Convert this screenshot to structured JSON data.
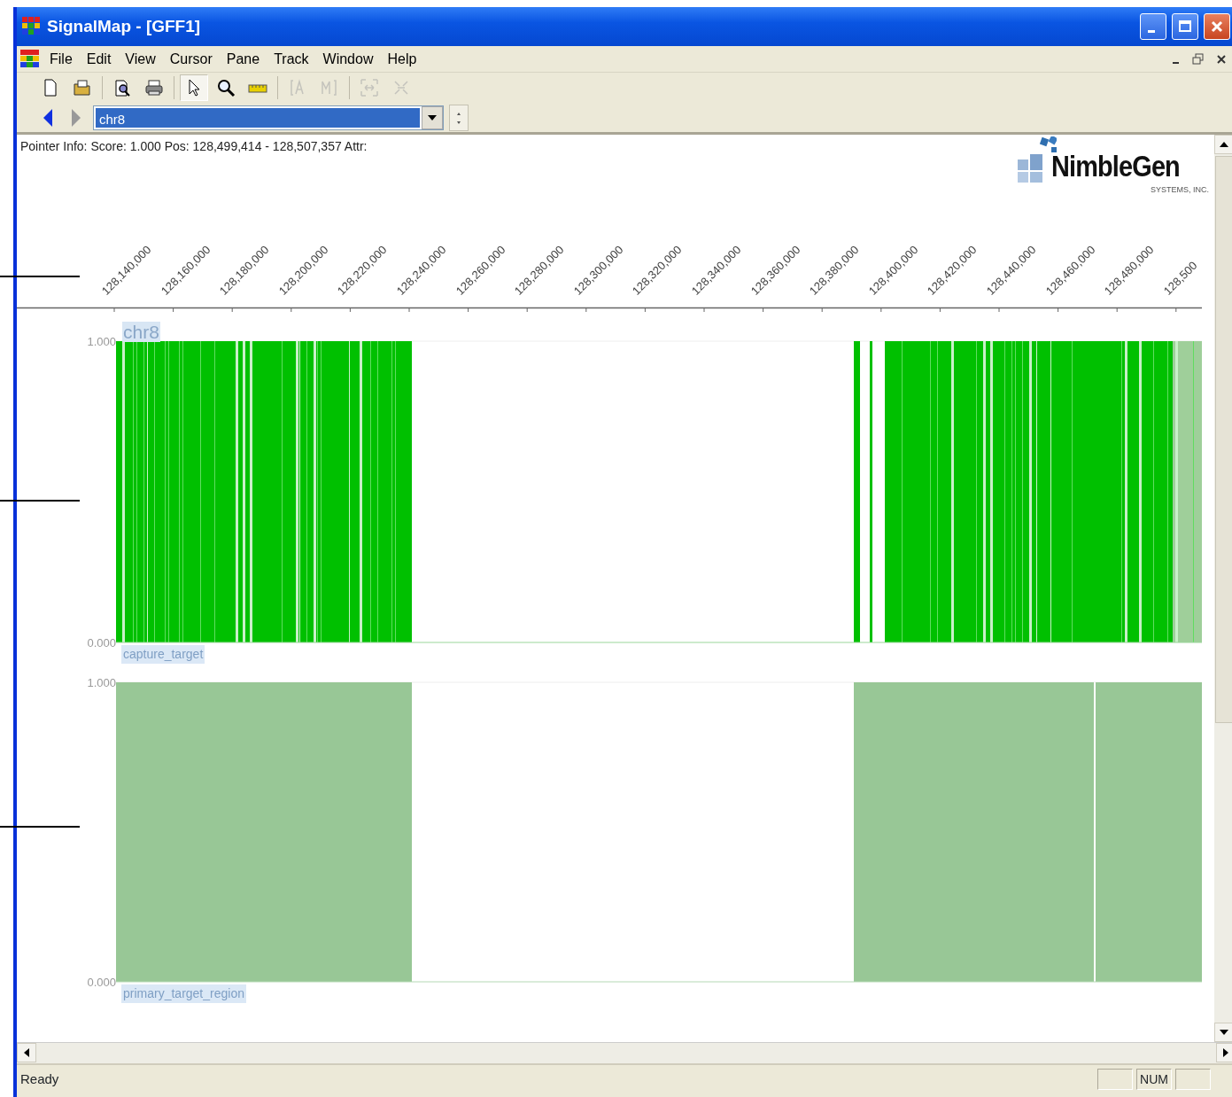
{
  "window": {
    "title": "SignalMap - [GFF1]"
  },
  "menu": [
    {
      "label": "File"
    },
    {
      "label": "Edit"
    },
    {
      "label": "View"
    },
    {
      "label": "Cursor"
    },
    {
      "label": "Pane"
    },
    {
      "label": "Track"
    },
    {
      "label": "Window"
    },
    {
      "label": "Help"
    }
  ],
  "toolbar": [
    {
      "kind": "new",
      "disabled": false,
      "selected": false
    },
    {
      "kind": "open",
      "disabled": false,
      "selected": false
    },
    {
      "kind": "sep"
    },
    {
      "kind": "preview",
      "disabled": false,
      "selected": false
    },
    {
      "kind": "print",
      "disabled": false,
      "selected": false
    },
    {
      "kind": "sep"
    },
    {
      "kind": "pointer",
      "disabled": false,
      "selected": true
    },
    {
      "kind": "zoom",
      "disabled": false,
      "selected": false
    },
    {
      "kind": "ruler",
      "disabled": false,
      "selected": false
    },
    {
      "kind": "sep"
    },
    {
      "kind": "start",
      "disabled": true,
      "selected": false
    },
    {
      "kind": "end",
      "disabled": true,
      "selected": false
    },
    {
      "kind": "sep"
    },
    {
      "kind": "fit",
      "disabled": true,
      "selected": false
    },
    {
      "kind": "unfit",
      "disabled": true,
      "selected": false
    }
  ],
  "navigator": {
    "back_disabled": false,
    "forward_disabled": true,
    "chromosome": "chr8"
  },
  "pointer_info": "Pointer Info: Score: 1.000 Pos: 128,499,414 - 128,507,357 Attr:",
  "logo": {
    "name": "NimbleGen",
    "subtitle": "SYSTEMS, INC."
  },
  "axis": {
    "ticks": [
      "128,140,000",
      "128,160,000",
      "128,180,000",
      "128,200,000",
      "128,220,000",
      "128,240,000",
      "128,260,000",
      "128,280,000",
      "128,300,000",
      "128,320,000",
      "128,340,000",
      "128,360,000",
      "128,380,000",
      "128,400,000",
      "128,420,000",
      "128,440,000",
      "128,460,000",
      "128,480,000",
      "128,500"
    ]
  },
  "tracks": [
    {
      "kind": "bars",
      "label": "chr8",
      "name": "capture_target",
      "ymax": "1.000",
      "ymin": "0.000"
    },
    {
      "kind": "blocks",
      "name": "primary_target_region",
      "ymax": "1.000",
      "ymin": "0.000"
    }
  ],
  "status_bar": {
    "text": "Ready",
    "indicator": "NUM"
  }
}
